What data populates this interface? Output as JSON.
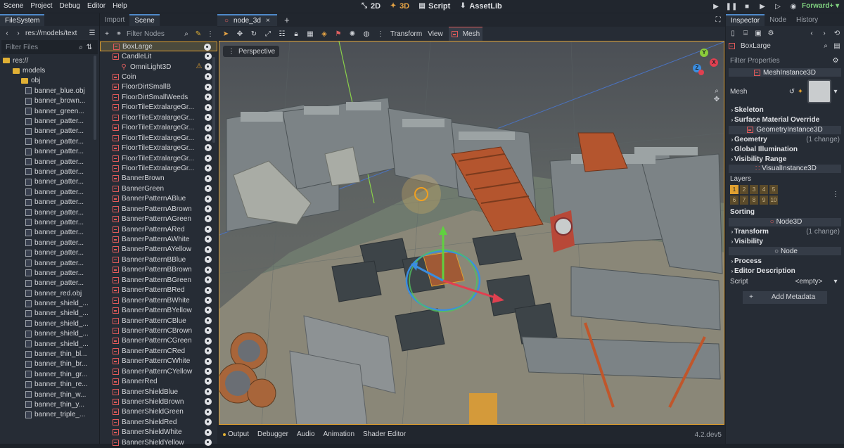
{
  "menubar": {
    "menus": [
      "Scene",
      "Project",
      "Debug",
      "Editor",
      "Help"
    ],
    "modes": [
      "2D",
      "3D",
      "Script",
      "AssetLib"
    ],
    "renderer": "Forward+"
  },
  "filesystem": {
    "tab": "FileSystem",
    "path": "res://models/text",
    "filter_placeholder": "Filter Files",
    "root": "res://",
    "folders": [
      "models",
      "obj"
    ],
    "files": [
      "banner_blue.obj",
      "banner_brown...",
      "banner_green...",
      "banner_patter...",
      "banner_patter...",
      "banner_patter...",
      "banner_patter...",
      "banner_patter...",
      "banner_patter...",
      "banner_patter...",
      "banner_patter...",
      "banner_patter...",
      "banner_patter...",
      "banner_patter...",
      "banner_patter...",
      "banner_patter...",
      "banner_patter...",
      "banner_patter...",
      "banner_patter...",
      "banner_patter...",
      "banner_red.obj",
      "banner_shield_...",
      "banner_shield_...",
      "banner_shield_...",
      "banner_shield_...",
      "banner_shield_...",
      "banner_thin_bl...",
      "banner_thin_br...",
      "banner_thin_gr...",
      "banner_thin_re...",
      "banner_thin_w...",
      "banner_thin_y...",
      "banner_triple_..."
    ]
  },
  "scene": {
    "tabs": [
      "Import",
      "Scene"
    ],
    "filter_placeholder": "Filter Nodes",
    "nodes": [
      {
        "name": "BoxLarge",
        "indent": 1,
        "selected": true
      },
      {
        "name": "CandleLit",
        "indent": 1
      },
      {
        "name": "OmniLight3D",
        "indent": 2,
        "light": true
      },
      {
        "name": "Coin",
        "indent": 1
      },
      {
        "name": "FloorDirtSmallB",
        "indent": 1
      },
      {
        "name": "FloorDirtSmallWeeds",
        "indent": 1
      },
      {
        "name": "FloorTileExtralargeGr...",
        "indent": 1
      },
      {
        "name": "FloorTileExtralargeGr...",
        "indent": 1
      },
      {
        "name": "FloorTileExtralargeGr...",
        "indent": 1
      },
      {
        "name": "FloorTileExtralargeGr...",
        "indent": 1
      },
      {
        "name": "FloorTileExtralargeGr...",
        "indent": 1
      },
      {
        "name": "FloorTileExtralargeGr...",
        "indent": 1
      },
      {
        "name": "FloorTileExtralargeGr...",
        "indent": 1
      },
      {
        "name": "BannerBrown",
        "indent": 1
      },
      {
        "name": "BannerGreen",
        "indent": 1
      },
      {
        "name": "BannerPatternABlue",
        "indent": 1
      },
      {
        "name": "BannerPatternABrown",
        "indent": 1
      },
      {
        "name": "BannerPatternAGreen",
        "indent": 1
      },
      {
        "name": "BannerPatternARed",
        "indent": 1
      },
      {
        "name": "BannerPatternAWhite",
        "indent": 1
      },
      {
        "name": "BannerPatternAYellow",
        "indent": 1
      },
      {
        "name": "BannerPatternBBlue",
        "indent": 1
      },
      {
        "name": "BannerPatternBBrown",
        "indent": 1
      },
      {
        "name": "BannerPatternBGreen",
        "indent": 1
      },
      {
        "name": "BannerPatternBRed",
        "indent": 1
      },
      {
        "name": "BannerPatternBWhite",
        "indent": 1
      },
      {
        "name": "BannerPatternBYellow",
        "indent": 1
      },
      {
        "name": "BannerPatternCBlue",
        "indent": 1
      },
      {
        "name": "BannerPatternCBrown",
        "indent": 1
      },
      {
        "name": "BannerPatternCGreen",
        "indent": 1
      },
      {
        "name": "BannerPatternCRed",
        "indent": 1
      },
      {
        "name": "BannerPatternCWhite",
        "indent": 1
      },
      {
        "name": "BannerPatternCYellow",
        "indent": 1
      },
      {
        "name": "BannerRed",
        "indent": 1
      },
      {
        "name": "BannerShieldBlue",
        "indent": 1
      },
      {
        "name": "BannerShieldBrown",
        "indent": 1
      },
      {
        "name": "BannerShieldGreen",
        "indent": 1
      },
      {
        "name": "BannerShieldRed",
        "indent": 1
      },
      {
        "name": "BannerShieldWhite",
        "indent": 1
      },
      {
        "name": "BannerShieldYellow",
        "indent": 1
      }
    ]
  },
  "editor": {
    "scene_tab": "node_3d",
    "toolbar": {
      "transform": "Transform",
      "view": "View",
      "mesh": "Mesh"
    },
    "perspective": "Perspective",
    "gizmo_axes": {
      "y": "Y",
      "x": "X",
      "z": "Z"
    },
    "bottom_tabs": [
      "Output",
      "Debugger",
      "Audio",
      "Animation",
      "Shader Editor"
    ],
    "version": "4.2.dev5"
  },
  "inspector": {
    "tabs": [
      "Inspector",
      "Node",
      "History"
    ],
    "object_name": "BoxLarge",
    "filter_placeholder": "Filter Properties",
    "mesh_instance_header": "MeshInstance3D",
    "mesh_label": "Mesh",
    "sections_a": [
      "Skeleton",
      "Surface Material Override"
    ],
    "geometry_header": "GeometryInstance3D",
    "sections_b": [
      {
        "label": "Geometry",
        "change": "(1 change)"
      },
      {
        "label": "Global Illumination",
        "change": ""
      },
      {
        "label": "Visibility Range",
        "change": ""
      }
    ],
    "visual_header": "VisualInstance3D",
    "layers_label": "Layers",
    "layers": [
      "1",
      "2",
      "3",
      "4",
      "5",
      "6",
      "7",
      "8",
      "9",
      "10"
    ],
    "sorting_label": "Sorting",
    "node3d_header": "Node3D",
    "sections_c": [
      {
        "label": "Transform",
        "change": "(1 change)"
      },
      {
        "label": "Visibility",
        "change": ""
      }
    ],
    "node_header": "Node",
    "sections_d": [
      "Process",
      "Editor Description"
    ],
    "script_label": "Script",
    "script_value": "<empty>",
    "add_metadata": "Add Metadata"
  },
  "colors": {
    "accent": "#4f89c9",
    "selection": "#e0a030",
    "mesh_icon": "#e05a5a"
  }
}
